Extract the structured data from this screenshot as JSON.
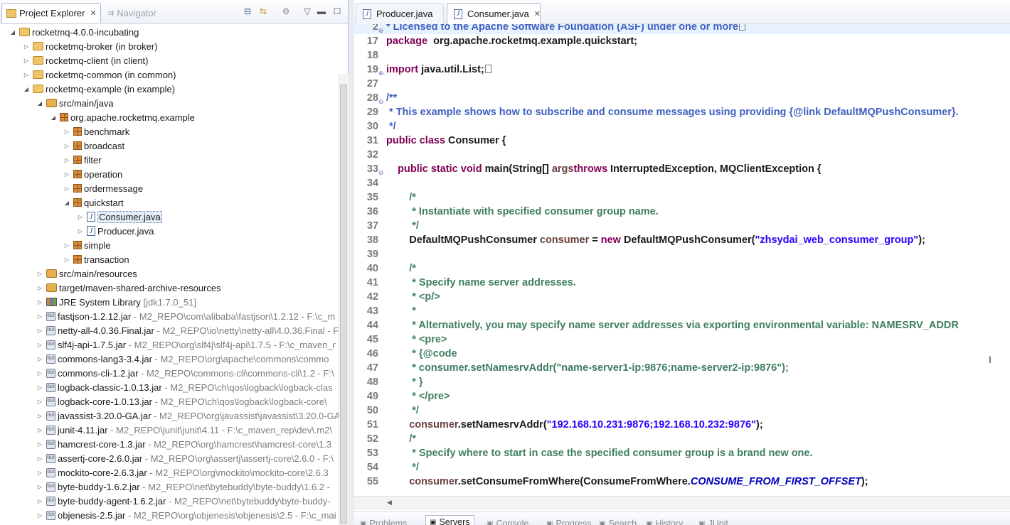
{
  "left_panel": {
    "tabs": [
      {
        "label": "Project Explorer",
        "icon": "project-explorer-icon",
        "active": true
      },
      {
        "label": "Navigator",
        "icon": "navigator-icon",
        "active": false
      }
    ],
    "tree": [
      {
        "label": "rocketmq-4.0.0-incubating",
        "suffix": "",
        "icon": "project-icon",
        "expanded": true
      },
      {
        "label": "rocketmq-broker (in broker)",
        "suffix": "",
        "icon": "project-icon",
        "expanded": false
      },
      {
        "label": "rocketmq-client (in client)",
        "suffix": "",
        "icon": "project-icon",
        "expanded": false
      },
      {
        "label": "rocketmq-common (in common)",
        "suffix": "",
        "icon": "project-icon",
        "expanded": false
      },
      {
        "label": "rocketmq-example (in example)",
        "suffix": "",
        "icon": "project-icon",
        "expanded": true
      },
      {
        "label": "src/main/java",
        "suffix": "",
        "icon": "source-folder-icon",
        "expanded": true
      },
      {
        "label": "org.apache.rocketmq.example",
        "suffix": "",
        "icon": "package-icon",
        "expanded": true
      },
      {
        "label": "benchmark",
        "suffix": "",
        "icon": "package-icon",
        "expanded": false
      },
      {
        "label": "broadcast",
        "suffix": "",
        "icon": "package-icon",
        "expanded": false
      },
      {
        "label": "filter",
        "suffix": "",
        "icon": "package-icon",
        "expanded": false
      },
      {
        "label": "operation",
        "suffix": "",
        "icon": "package-icon",
        "expanded": false
      },
      {
        "label": "ordermessage",
        "suffix": "",
        "icon": "package-icon",
        "expanded": false
      },
      {
        "label": "quickstart",
        "suffix": "",
        "icon": "package-icon",
        "expanded": true
      },
      {
        "label": "Consumer.java",
        "suffix": "",
        "icon": "java-file-icon",
        "expanded": false
      },
      {
        "label": "Producer.java",
        "suffix": "",
        "icon": "java-file-icon",
        "expanded": false
      },
      {
        "label": "simple",
        "suffix": "",
        "icon": "package-icon",
        "expanded": false
      },
      {
        "label": "transaction",
        "suffix": "",
        "icon": "package-icon",
        "expanded": false
      },
      {
        "label": "src/main/resources",
        "suffix": "",
        "icon": "source-folder-icon",
        "expanded": false
      },
      {
        "label": "target/maven-shared-archive-resources",
        "suffix": "",
        "icon": "source-folder-icon",
        "expanded": false
      },
      {
        "label": "JRE System Library",
        "suffix": " [jdk1.7.0_51]",
        "icon": "library-icon",
        "expanded": false
      },
      {
        "label": "fastjson-1.2.12.jar",
        "suffix": " - M2_REPO\\com\\alibaba\\fastjson\\1.2.12 - F:\\c_m",
        "icon": "jar-icon",
        "expanded": false
      },
      {
        "label": "netty-all-4.0.36.Final.jar",
        "suffix": " - M2_REPO\\io\\netty\\netty-all\\4.0.36.Final - F",
        "icon": "jar-icon",
        "expanded": false
      },
      {
        "label": "slf4j-api-1.7.5.jar",
        "suffix": " - M2_REPO\\org\\slf4j\\slf4j-api\\1.7.5 - F:\\c_maven_r",
        "icon": "jar-icon",
        "expanded": false
      },
      {
        "label": "commons-lang3-3.4.jar",
        "suffix": " - M2_REPO\\org\\apache\\commons\\commo",
        "icon": "jar-icon",
        "expanded": false
      },
      {
        "label": "commons-cli-1.2.jar",
        "suffix": " - M2_REPO\\commons-cli\\commons-cli\\1.2 - F:\\",
        "icon": "jar-icon",
        "expanded": false
      },
      {
        "label": "logback-classic-1.0.13.jar",
        "suffix": " - M2_REPO\\ch\\qos\\logback\\logback-clas",
        "icon": "jar-icon",
        "expanded": false
      },
      {
        "label": "logback-core-1.0.13.jar",
        "suffix": " - M2_REPO\\ch\\qos\\logback\\logback-core\\",
        "icon": "jar-icon",
        "expanded": false
      },
      {
        "label": "javassist-3.20.0-GA.jar",
        "suffix": " - M2_REPO\\org\\javassist\\javassist\\3.20.0-GA",
        "icon": "jar-icon",
        "expanded": false
      },
      {
        "label": "junit-4.11.jar",
        "suffix": " - M2_REPO\\junit\\junit\\4.11 - F:\\c_maven_rep\\dev\\.m2\\",
        "icon": "jar-icon",
        "expanded": false
      },
      {
        "label": "hamcrest-core-1.3.jar",
        "suffix": " - M2_REPO\\org\\hamcrest\\hamcrest-core\\1.3",
        "icon": "jar-icon",
        "expanded": false
      },
      {
        "label": "assertj-core-2.6.0.jar",
        "suffix": " - M2_REPO\\org\\assertj\\assertj-core\\2.6.0 - F:\\",
        "icon": "jar-icon",
        "expanded": false
      },
      {
        "label": "mockito-core-2.6.3.jar",
        "suffix": " - M2_REPO\\org\\mockito\\mockito-core\\2.6.3",
        "icon": "jar-icon",
        "expanded": false
      },
      {
        "label": "byte-buddy-1.6.2.jar",
        "suffix": " - M2_REPO\\net\\bytebuddy\\byte-buddy\\1.6.2 -",
        "icon": "jar-icon",
        "expanded": false
      },
      {
        "label": "byte-buddy-agent-1.6.2.jar",
        "suffix": " - M2_REPO\\net\\bytebuddy\\byte-buddy-",
        "icon": "jar-icon",
        "expanded": false
      },
      {
        "label": "objenesis-2.5.jar",
        "suffix": " - M2_REPO\\org\\objenesis\\objenesis\\2.5 - F:\\c_mai",
        "icon": "jar-icon",
        "expanded": false
      }
    ]
  },
  "editor": {
    "tabs": [
      {
        "label": "Producer.java",
        "active": false
      },
      {
        "label": "Consumer.java",
        "active": true
      }
    ],
    "lines": [
      {
        "n": "2",
        "fold": "+",
        "segs": [
          [
            "jd",
            "* Licensed to the Apache Software Foundation (ASF) under one or more"
          ],
          [
            "box",
            ""
          ]
        ]
      },
      {
        "n": "17",
        "fold": "",
        "segs": [
          [
            "kw",
            "package"
          ],
          [
            "",
            "  org.apache.rocketmq.example.quickstart;"
          ]
        ]
      },
      {
        "n": "18",
        "fold": "",
        "segs": []
      },
      {
        "n": "19",
        "fold": "+",
        "segs": [
          [
            "kw",
            "import"
          ],
          [
            "",
            " java.util.List;"
          ],
          [
            "box",
            ""
          ]
        ]
      },
      {
        "n": "27",
        "fold": "",
        "segs": []
      },
      {
        "n": "28",
        "fold": "-",
        "segs": [
          [
            "jd",
            "/**"
          ]
        ]
      },
      {
        "n": "29",
        "fold": "",
        "segs": [
          [
            "jd",
            " * This example shows how to subscribe and consume messages using providing {@link DefaultMQPushConsumer}."
          ]
        ]
      },
      {
        "n": "30",
        "fold": "",
        "segs": [
          [
            "jd",
            " */"
          ]
        ]
      },
      {
        "n": "31",
        "fold": "",
        "segs": [
          [
            "kw",
            "public class"
          ],
          [
            "",
            " Consumer {"
          ]
        ]
      },
      {
        "n": "32",
        "fold": "",
        "segs": []
      },
      {
        "n": "33",
        "fold": "-",
        "segs": [
          [
            "",
            "    "
          ],
          [
            "kw",
            "public static void"
          ],
          [
            "",
            " main(String[] "
          ],
          [
            "lv",
            "args"
          ],
          [
            ") "
          ],
          [
            "kw",
            "throws"
          ],
          [
            "",
            " InterruptedException, MQClientException {"
          ]
        ]
      },
      {
        "n": "34",
        "fold": "",
        "segs": []
      },
      {
        "n": "35",
        "fold": "",
        "segs": [
          [
            "",
            "        "
          ],
          [
            "cm",
            "/*"
          ]
        ]
      },
      {
        "n": "36",
        "fold": "",
        "segs": [
          [
            "",
            "        "
          ],
          [
            "cm",
            " * Instantiate with specified consumer group name."
          ]
        ]
      },
      {
        "n": "37",
        "fold": "",
        "segs": [
          [
            "",
            "        "
          ],
          [
            "cm",
            " */"
          ]
        ]
      },
      {
        "n": "38",
        "fold": "",
        "segs": [
          [
            "",
            "        DefaultMQPushConsumer "
          ],
          [
            "lv",
            "consumer"
          ],
          [
            "",
            " = "
          ],
          [
            "kw",
            "new"
          ],
          [
            "",
            " DefaultMQPushConsumer("
          ],
          [
            "st",
            "\"zhsydai_web_consumer_group\""
          ],
          [
            "",
            ");"
          ]
        ]
      },
      {
        "n": "39",
        "fold": "",
        "segs": []
      },
      {
        "n": "40",
        "fold": "",
        "segs": [
          [
            "",
            "        "
          ],
          [
            "cm",
            "/*"
          ]
        ]
      },
      {
        "n": "41",
        "fold": "",
        "segs": [
          [
            "",
            "        "
          ],
          [
            "cm",
            " * Specify name server addresses."
          ]
        ]
      },
      {
        "n": "42",
        "fold": "",
        "segs": [
          [
            "",
            "        "
          ],
          [
            "cm",
            " * <p/>"
          ]
        ]
      },
      {
        "n": "43",
        "fold": "",
        "segs": [
          [
            "",
            "        "
          ],
          [
            "cm",
            " *"
          ]
        ]
      },
      {
        "n": "44",
        "fold": "",
        "segs": [
          [
            "",
            "        "
          ],
          [
            "cm",
            " * Alternatively, you may specify name server addresses via exporting environmental variable: NAMESRV_ADDR"
          ]
        ]
      },
      {
        "n": "45",
        "fold": "",
        "segs": [
          [
            "",
            "        "
          ],
          [
            "cm",
            " * <pre>"
          ]
        ]
      },
      {
        "n": "46",
        "fold": "",
        "segs": [
          [
            "",
            "        "
          ],
          [
            "cm",
            " * {@code"
          ]
        ]
      },
      {
        "n": "47",
        "fold": "",
        "segs": [
          [
            "",
            "        "
          ],
          [
            "cm",
            " * consumer.setNamesrvAddr(\"name-server1-ip:9876;name-server2-ip:9876\");"
          ]
        ]
      },
      {
        "n": "48",
        "fold": "",
        "segs": [
          [
            "",
            "        "
          ],
          [
            "cm",
            " * }"
          ]
        ]
      },
      {
        "n": "49",
        "fold": "",
        "segs": [
          [
            "",
            "        "
          ],
          [
            "cm",
            " * </pre>"
          ]
        ]
      },
      {
        "n": "50",
        "fold": "",
        "segs": [
          [
            "",
            "        "
          ],
          [
            "cm",
            " */"
          ]
        ]
      },
      {
        "n": "51",
        "fold": "",
        "segs": [
          [
            "",
            "        "
          ],
          [
            "lv",
            "consumer"
          ],
          [
            "",
            ".setNamesrvAddr("
          ],
          [
            "st",
            "\"192.168.10.231:9876;192.168.10.232:9876\""
          ],
          [
            "",
            ");"
          ]
        ]
      },
      {
        "n": "52",
        "fold": "",
        "segs": [
          [
            "",
            "        "
          ],
          [
            "cm",
            "/*"
          ]
        ]
      },
      {
        "n": "53",
        "fold": "",
        "segs": [
          [
            "",
            "        "
          ],
          [
            "cm",
            " * Specify where to start in case the specified consumer group is a brand new one."
          ]
        ]
      },
      {
        "n": "54",
        "fold": "",
        "segs": [
          [
            "",
            "        "
          ],
          [
            "cm",
            " */"
          ]
        ]
      },
      {
        "n": "55",
        "fold": "",
        "segs": [
          [
            "",
            "        "
          ],
          [
            "lv",
            "consumer"
          ],
          [
            "",
            ".setConsumeFromWhere(ConsumeFromWhere."
          ],
          [
            "it",
            "CONSUME_FROM_FIRST_OFFSET"
          ],
          [
            "",
            ");"
          ]
        ]
      }
    ]
  },
  "bottom_tabs": [
    {
      "label": "Problems",
      "active": false
    },
    {
      "label": "Servers",
      "active": true
    },
    {
      "label": "Console",
      "active": false
    },
    {
      "label": "Progress",
      "active": false
    },
    {
      "label": "Search",
      "active": false
    },
    {
      "label": "History",
      "active": false
    },
    {
      "label": "JUnit",
      "active": false
    }
  ]
}
